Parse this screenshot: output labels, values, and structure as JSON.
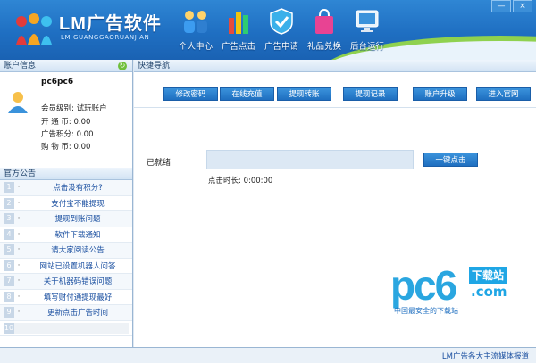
{
  "app": {
    "title": "LM广告软件",
    "subtitle": "LM GUANGGAORUANJIAN"
  },
  "nav": [
    {
      "label": "个人中心",
      "icon": "people-icon"
    },
    {
      "label": "广告点击",
      "icon": "bar-chart-icon"
    },
    {
      "label": "广告申请",
      "icon": "shield-check-icon"
    },
    {
      "label": "礼品兑换",
      "icon": "shopping-bag-icon"
    },
    {
      "label": "后台运行",
      "icon": "monitor-icon"
    }
  ],
  "window_buttons": {
    "minimize": "—",
    "close": "×"
  },
  "account_panel": {
    "title": "账户信息",
    "username": "pc6pc6",
    "level": "会员级别: 试玩账户",
    "open_coins": "开 通 币: 0.00",
    "ad_points": "广告积分: 0.00",
    "shop_coins": "购 物 币: 0.00"
  },
  "notice_panel": {
    "title": "官方公告",
    "items": [
      {
        "num": "1",
        "text": "点击没有积分?"
      },
      {
        "num": "2",
        "text": "支付宝不能提现"
      },
      {
        "num": "3",
        "text": "提现到账问题"
      },
      {
        "num": "4",
        "text": "软件下载通知"
      },
      {
        "num": "5",
        "text": "请大家阅读公告"
      },
      {
        "num": "6",
        "text": "网站已设置机器人问答"
      },
      {
        "num": "7",
        "text": "关于机器码错误问题"
      },
      {
        "num": "8",
        "text": "填写财付通提现最好"
      },
      {
        "num": "9",
        "text": "更新点击广告时间"
      },
      {
        "num": "10",
        "text": ""
      }
    ]
  },
  "quick_nav": {
    "title": "快捷导航",
    "buttons": [
      "修改密码",
      "在线充值",
      "提现转账",
      "提现记录",
      "账户升级",
      "进入官网"
    ]
  },
  "main": {
    "ready_label": "已就绪",
    "onekey_button": "一键点击",
    "click_time": "点击时长: 0:00:00"
  },
  "watermark": {
    "brand": "pc6",
    "download": "下载站",
    "domain": ".com",
    "slogan": "中国最安全的下载站"
  },
  "footer": {
    "link": "LM广告各大主流媒体报道"
  }
}
